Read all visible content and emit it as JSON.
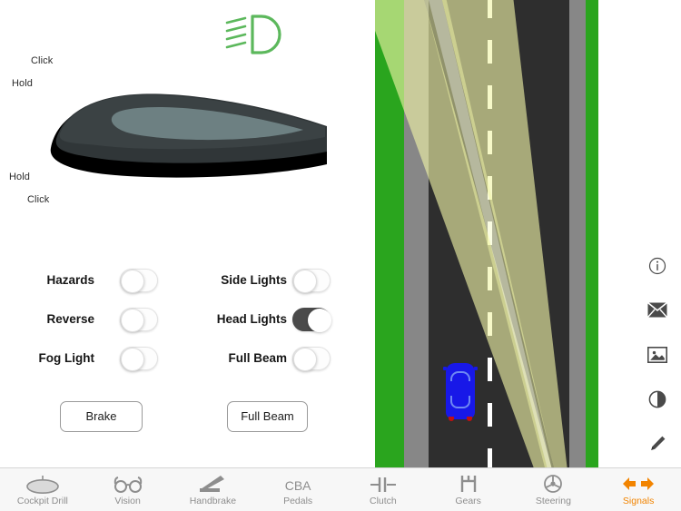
{
  "colors": {
    "accent": "#f28400",
    "grass": "#2aa51e",
    "shoulder": "#878787",
    "asphalt": "#2e2e2e",
    "lane_marking": "#ffffff",
    "beam": "#f2f5a8",
    "car": "#1818e8",
    "car_taillight": "#c21010",
    "indicator_green": "#5cb85c",
    "toggle_on": "#4a4a4a",
    "tab_inactive": "#8e8e8e"
  },
  "indicator": {
    "name": "headlight-beam-indicator",
    "state": "on"
  },
  "stalk": {
    "name": "indicator-stalk",
    "labels": {
      "click_top": "Click",
      "hold_top": "Hold",
      "hold_bottom": "Hold",
      "click_bottom": "Click"
    }
  },
  "controls": {
    "toggles": [
      {
        "id": "hazards",
        "label": "Hazards",
        "state": "off",
        "column": "left"
      },
      {
        "id": "reverse",
        "label": "Reverse",
        "state": "off",
        "column": "left"
      },
      {
        "id": "fog-light",
        "label": "Fog Light",
        "state": "off",
        "column": "left"
      },
      {
        "id": "side-lights",
        "label": "Side Lights",
        "state": "off",
        "column": "right"
      },
      {
        "id": "head-lights",
        "label": "Head Lights",
        "state": "on",
        "column": "right"
      },
      {
        "id": "full-beam",
        "label": "Full Beam",
        "state": "off",
        "column": "right"
      }
    ],
    "buttons": [
      {
        "id": "brake",
        "label": "Brake"
      },
      {
        "id": "full-beam",
        "label": "Full Beam"
      }
    ]
  },
  "rail": {
    "items": [
      {
        "id": "info",
        "icon": "info-icon"
      },
      {
        "id": "mail",
        "icon": "envelope-icon"
      },
      {
        "id": "image",
        "icon": "image-icon"
      },
      {
        "id": "contrast",
        "icon": "contrast-icon"
      },
      {
        "id": "edit",
        "icon": "pencil-icon"
      }
    ]
  },
  "tabbar": {
    "items": [
      {
        "id": "cockpit-drill",
        "label": "Cockpit Drill",
        "icon": "steering-wheel-oval-icon",
        "active": false
      },
      {
        "id": "vision",
        "label": "Vision",
        "icon": "glasses-icon",
        "active": false
      },
      {
        "id": "handbrake",
        "label": "Handbrake",
        "icon": "handbrake-lever-icon",
        "active": false
      },
      {
        "id": "pedals",
        "label": "Pedals",
        "icon": "cba-text-icon",
        "icon_text": "CBA",
        "active": false
      },
      {
        "id": "clutch",
        "label": "Clutch",
        "icon": "clutch-pedal-icon",
        "active": false
      },
      {
        "id": "gears",
        "label": "Gears",
        "icon": "gear-stick-h-pattern-icon",
        "active": false
      },
      {
        "id": "steering",
        "label": "Steering",
        "icon": "steering-wheel-icon",
        "active": false
      },
      {
        "id": "signals",
        "label": "Signals",
        "icon": "双-arrow-icon",
        "active": true
      }
    ]
  }
}
